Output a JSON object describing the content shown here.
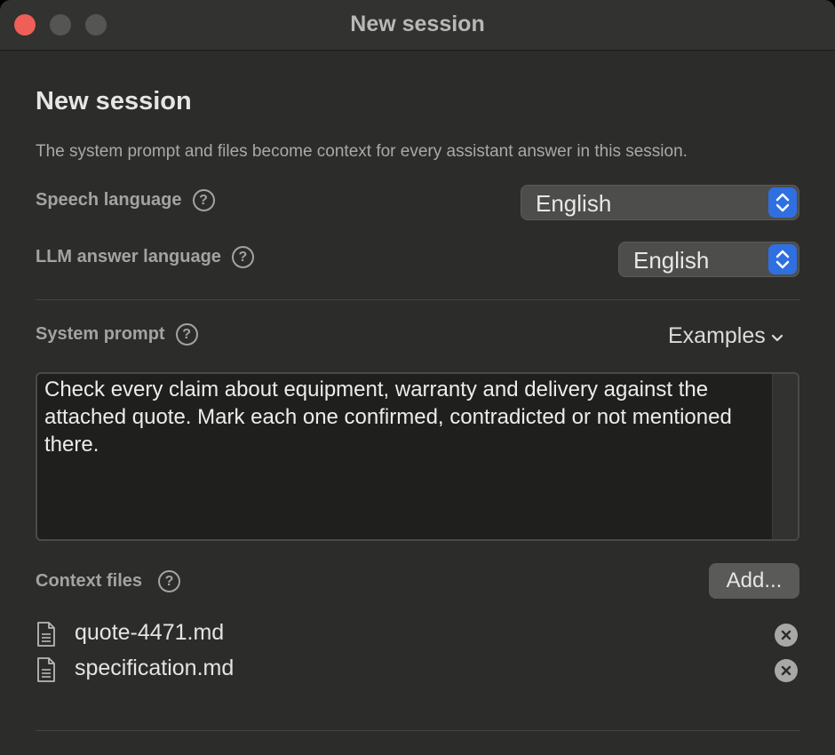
{
  "window": {
    "title": "New session"
  },
  "header": {
    "title": "New session",
    "description": "The system prompt and files become context for every assistant answer in this session."
  },
  "speech_language": {
    "label": "Speech language",
    "help": "?",
    "value": "English"
  },
  "llm_language": {
    "label": "LLM answer language",
    "help": "?",
    "value": "English"
  },
  "system_prompt": {
    "label": "System prompt",
    "help": "?",
    "examples_label": "Examples",
    "value": "Check every claim about equipment, warranty and delivery against the attached quote. Mark each one confirmed, contradicted or not mentioned there."
  },
  "context_files": {
    "label": "Context files",
    "help": "?",
    "add_label": "Add...",
    "files": [
      {
        "name": "quote-4471.md",
        "icon": "document-icon"
      },
      {
        "name": "specification.md",
        "icon": "document-icon"
      }
    ]
  },
  "colors": {
    "accent": "#2f6fe0",
    "close": "#ee5f57"
  }
}
